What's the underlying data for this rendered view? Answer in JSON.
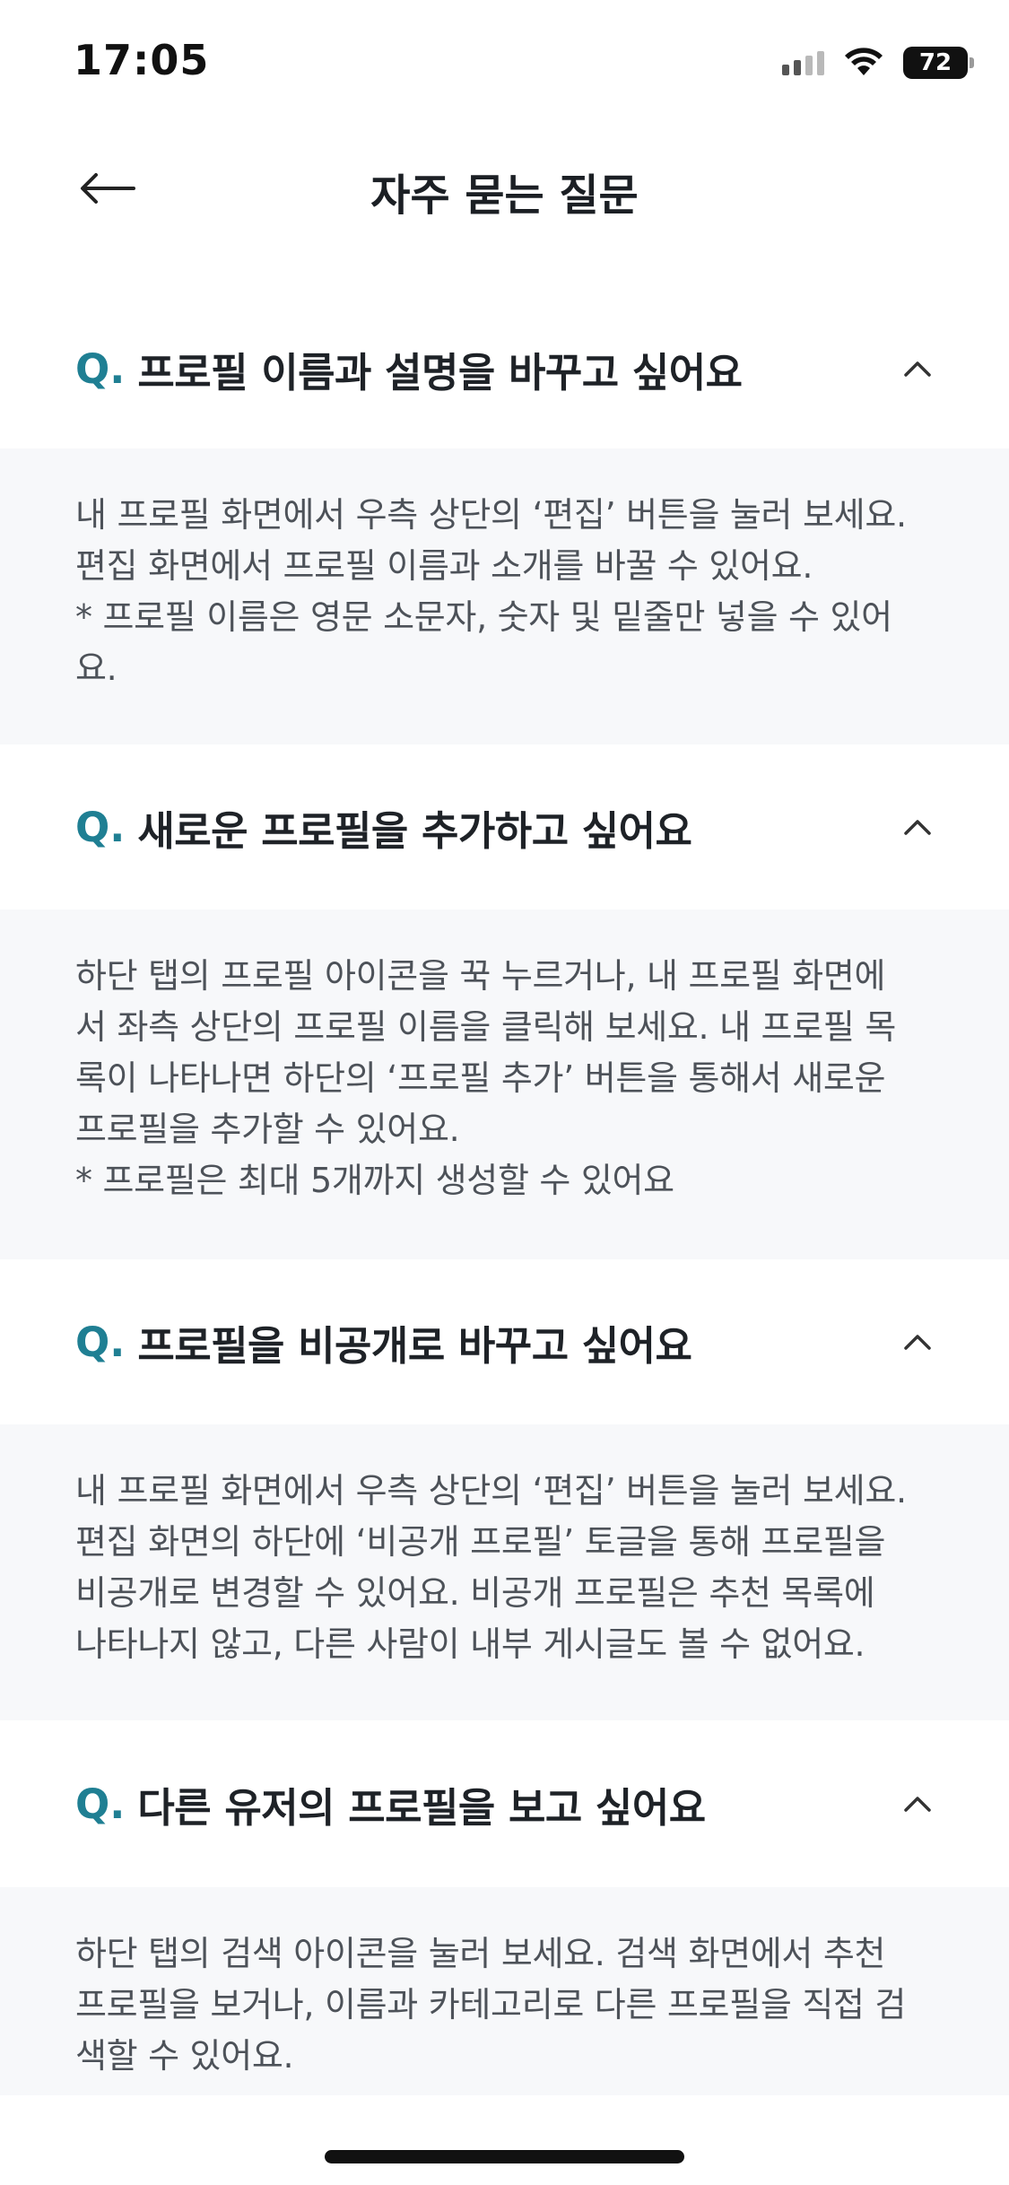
{
  "status_bar": {
    "time": "17:05",
    "battery": "72"
  },
  "header": {
    "title": "자주 묻는 질문"
  },
  "faq": [
    {
      "q_mark": "Q.",
      "question": "프로필 이름과 설명을 바꾸고 싶어요",
      "answer": "내 프로필 화면에서 우측 상단의 ‘편집’ 버튼을 눌러 보세요.\n편집 화면에서 프로필 이름과 소개를 바꿀 수 있어요.\n* 프로필 이름은 영문 소문자, 숫자 및 밑줄만 넣을 수 있어\n요."
    },
    {
      "q_mark": "Q.",
      "question": "새로운 프로필을 추가하고 싶어요",
      "answer": "하단 탭의 프로필 아이콘을 꾹 누르거나, 내 프로필 화면에\n서 좌측 상단의 프로필 이름을 클릭해 보세요. 내 프로필 목\n록이 나타나면 하단의 ‘프로필 추가’ 버튼을 통해서 새로운\n프로필을 추가할 수 있어요.\n* 프로필은 최대 5개까지 생성할 수 있어요"
    },
    {
      "q_mark": "Q.",
      "question": "프로필을 비공개로 바꾸고 싶어요",
      "answer": "내 프로필 화면에서 우측 상단의 ‘편집’ 버튼을 눌러 보세요.\n편집 화면의 하단에 ‘비공개 프로필’ 토글을 통해 프로필을\n비공개로 변경할 수 있어요. 비공개 프로필은 추천 목록에\n나타나지 않고, 다른 사람이 내부 게시글도 볼 수 없어요."
    },
    {
      "q_mark": "Q.",
      "question": "다른 유저의 프로필을 보고 싶어요",
      "answer": "하단 탭의 검색 아이콘을 눌러 보세요. 검색 화면에서 추천\n프로필을 보거나, 이름과 카테고리로 다른 프로필을 직접 검\n색할 수 있어요."
    }
  ]
}
